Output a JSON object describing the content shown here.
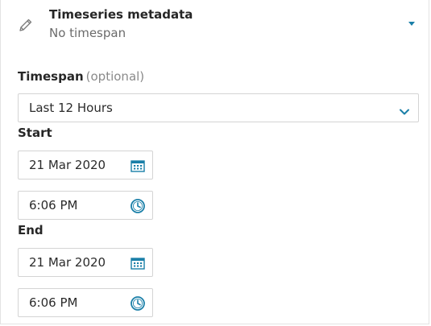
{
  "header": {
    "title": "Timeseries metadata",
    "subtitle": "No timespan",
    "pencil_icon": "pencil-icon",
    "expand_icon": "caret-down-icon"
  },
  "timespan": {
    "label": "Timespan",
    "optional_hint": "(optional)",
    "selected": "Last 12 Hours",
    "dropdown_icon": "chevron-down-icon"
  },
  "start": {
    "label": "Start",
    "date": "21 Mar 2020",
    "time": "6:06 PM",
    "calendar_icon": "calendar-icon",
    "clock_icon": "clock-icon"
  },
  "end": {
    "label": "End",
    "date": "21 Mar 2020",
    "time": "6:06 PM",
    "calendar_icon": "calendar-icon",
    "clock_icon": "clock-icon"
  },
  "colors": {
    "accent": "#1a7fa8",
    "border": "#d4d4d4",
    "muted_text": "#6b6b6b"
  }
}
